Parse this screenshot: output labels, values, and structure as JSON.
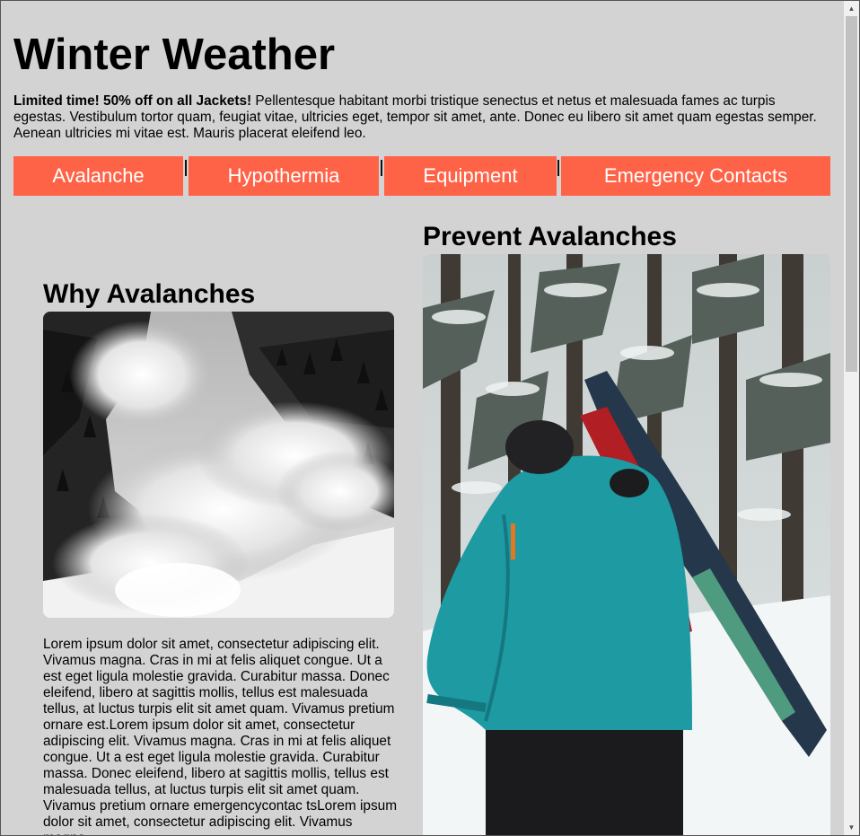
{
  "header": {
    "title": "Winter Weather"
  },
  "promo": {
    "highlight": "Limited time! 50% off on all Jackets!",
    "text": " Pellentesque habitant morbi tristique senectus et netus et malesuada fames ac turpis egestas. Vestibulum tortor quam, feugiat vitae, ultricies eget, tempor sit amet, ante. Donec eu libero sit amet quam egestas semper. Aenean ultricies mi vitae est. Mauris placerat eleifend leo."
  },
  "nav": {
    "items": [
      {
        "label": "Avalanche"
      },
      {
        "label": "Hypothermia"
      },
      {
        "label": "Equipment"
      },
      {
        "label": "Emergency Contacts"
      }
    ]
  },
  "sections": {
    "why": {
      "heading": "Why Avalanches",
      "body": "Lorem ipsum dolor sit amet, consectetur adipiscing elit. Vivamus magna. Cras in mi at felis aliquet congue. Ut a est eget ligula molestie gravida. Curabitur massa. Donec eleifend, libero at sagittis mollis, tellus est malesuada tellus, at luctus turpis elit sit amet quam. Vivamus pretium ornare est.Lorem ipsum dolor sit amet, consectetur adipiscing elit. Vivamus magna. Cras in mi at felis aliquet congue. Ut a est eget ligula molestie gravida. Curabitur massa. Donec eleifend, libero at sagittis mollis, tellus est malesuada tellus, at luctus turpis elit sit amet quam. Vivamus pretium ornare emergencycontac tsLorem ipsum dolor sit amet, consectetur adipiscing elit. Vivamus magna."
    },
    "prevent": {
      "heading": "Prevent Avalanches"
    }
  },
  "icons": {
    "scroll_up": "scroll-up-arrow-icon",
    "scroll_down": "scroll-down-arrow-icon"
  },
  "colors": {
    "background": "#d3d3d3",
    "nav_background": "#ff6347",
    "nav_text": "#ffffff",
    "jacket": "#1e9aa3"
  }
}
